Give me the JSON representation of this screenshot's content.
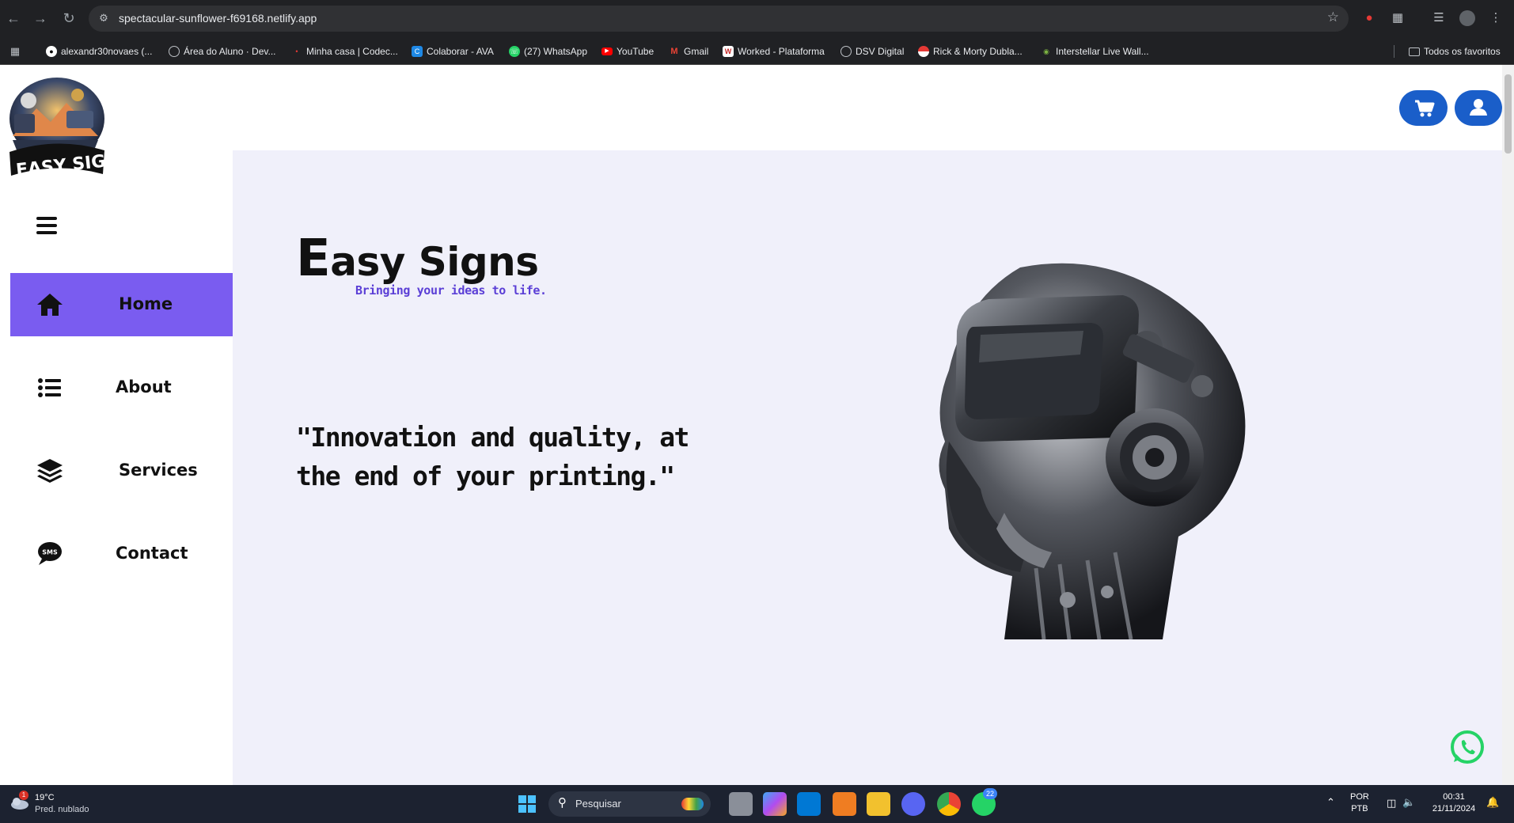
{
  "browser": {
    "url": "spectacular-sunflower-f69168.netlify.app",
    "bookmarks": [
      {
        "label": "alexandr30novaes (...",
        "icon": "github-icon"
      },
      {
        "label": "Área do Aluno · Dev...",
        "icon": "globe-icon"
      },
      {
        "label": "Minha casa | Codec...",
        "icon": "codec-icon"
      },
      {
        "label": "Colaborar - AVA",
        "icon": "colaborar-icon"
      },
      {
        "label": "(27) WhatsApp",
        "icon": "whatsapp-icon"
      },
      {
        "label": "YouTube",
        "icon": "youtube-icon"
      },
      {
        "label": "Gmail",
        "icon": "gmail-icon"
      },
      {
        "label": "Worked - Plataforma",
        "icon": "worked-icon"
      },
      {
        "label": "DSV Digital",
        "icon": "globe-icon"
      },
      {
        "label": "Rick & Morty Dubla...",
        "icon": "pokeball-icon"
      },
      {
        "label": "Interstellar Live Wall...",
        "icon": "alien-icon"
      }
    ],
    "all_bookmarks": "Todos os favoritos"
  },
  "site": {
    "logo_text": "EASY SIGNS",
    "nav": [
      {
        "label": "Home",
        "icon": "home-icon",
        "active": true
      },
      {
        "label": "About",
        "icon": "list-icon",
        "active": false
      },
      {
        "label": "Services",
        "icon": "layers-icon",
        "active": false
      },
      {
        "label": "Contact",
        "icon": "sms-icon",
        "active": false
      }
    ],
    "brand_first": "E",
    "brand_rest": "asy Signs",
    "tagline": "Bringing your ideas to life.",
    "quote": "\"Innovation and quality, at the end of your printing.\"",
    "accent_color": "#7a5cf0",
    "button_color": "#1a5ec9"
  },
  "taskbar": {
    "temperature": "19°C",
    "weather": "Pred. nublado",
    "weather_badge": "1",
    "search_placeholder": "Pesquisar",
    "whatsapp_badge": "22",
    "lang_top": "POR",
    "lang_bottom": "PTB",
    "time": "00:31",
    "date": "21/11/2024"
  }
}
